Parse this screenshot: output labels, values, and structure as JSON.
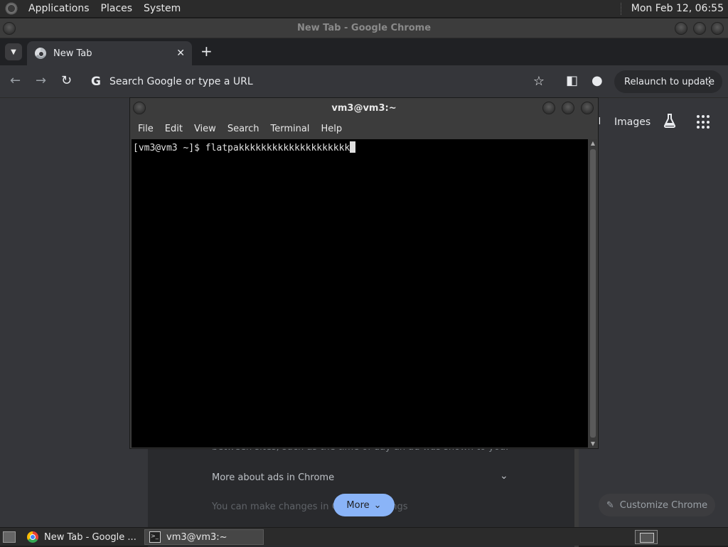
{
  "top_panel": {
    "menus": [
      "Applications",
      "Places",
      "System"
    ],
    "clock": "Mon Feb 12, 06:55"
  },
  "chrome": {
    "window_title": "New Tab - Google Chrome",
    "tab_title": "New Tab",
    "omnibox_placeholder": "Search Google or type a URL",
    "relaunch_label": "Relaunch to update",
    "ntp": {
      "gmail_partial": "il",
      "images_link": "Images",
      "faded_text": "between sites, such as the time of day an ad was shown to you.",
      "more_about": "More about ads in Chrome",
      "changes_text": "You can make changes in Chrome settings",
      "more_button": "More",
      "customize_button": "Customize Chrome"
    }
  },
  "terminal": {
    "window_title": "vm3@vm3:~",
    "menus": [
      "File",
      "Edit",
      "View",
      "Search",
      "Terminal",
      "Help"
    ],
    "prompt": "[vm3@vm3 ~]$ ",
    "command": "flatpakkkkkkkkkkkkkkkkkkkk"
  },
  "taskbar": {
    "tasks": [
      {
        "label": "New Tab - Google ...",
        "active": false
      },
      {
        "label": "vm3@vm3:~",
        "active": true
      }
    ]
  },
  "icons": {
    "star": "star-icon",
    "back": "arrow-left-icon",
    "forward": "arrow-right-icon",
    "reload": "reload-icon"
  }
}
